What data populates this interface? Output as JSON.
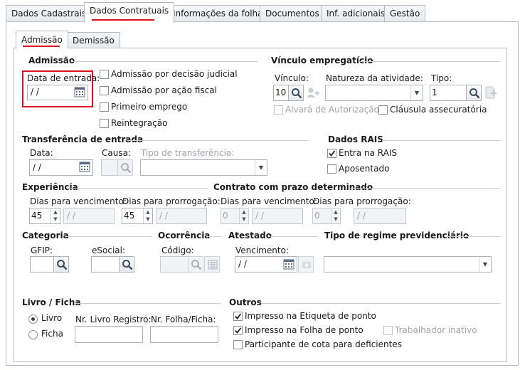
{
  "tabs": [
    "Dados Cadastrais",
    "Dados Contratuais",
    "Informações da folha",
    "Documentos",
    "Inf. adicionais",
    "Gestão"
  ],
  "subtabs": [
    "Admissão",
    "Demissão"
  ],
  "admissao": {
    "title": "Admissão",
    "data_entrada_label": "Data de entrada:",
    "data_entrada_value": " /  /",
    "checks": [
      "Admissão por decisão judicial",
      "Admissão por ação fiscal",
      "Primeiro emprego",
      "Reintegração"
    ]
  },
  "vinculo": {
    "title": "Vínculo empregatício",
    "vinculo_label": "Vínculo:",
    "vinculo_value": "10",
    "natureza_label": "Natureza da atividade:",
    "tipo_label": "Tipo:",
    "tipo_value": "1",
    "alvara": "Alvará de Autorização",
    "clausula": "Cláusula assecuratória"
  },
  "transferencia": {
    "title": "Transferência de entrada",
    "data_label": "Data:",
    "data_value": " /  /",
    "causa_label": "Causa:",
    "tipo_label": "Tipo de transferência:"
  },
  "rais": {
    "title": "Dados RAIS",
    "entra": "Entra na RAIS",
    "aposentado": "Aposentado"
  },
  "experiencia": {
    "title": "Experiência",
    "venc_label": "Dias para vencimento:",
    "venc_value": "45",
    "venc_date": " /  /",
    "prorrog_label": "Dias para prorrogação:",
    "prorrog_value": "45",
    "prorrog_date": " /  /"
  },
  "contrato": {
    "title": "Contrato com prazo determinado",
    "venc_label": "Dias para vencimento:",
    "venc_value": "0",
    "venc_date": " /  /",
    "prorrog_label": "Dias para prorrogação:",
    "prorrog_value": "0",
    "prorrog_date": " /  /"
  },
  "categoria": {
    "title": "Categoria",
    "gfip": "GFIP:",
    "esocial": "eSocial:"
  },
  "ocorrencia": {
    "title": "Ocorrência",
    "codigo": "Código:"
  },
  "atestado": {
    "title": "Atestado",
    "venc_label": "Vencimento:",
    "venc_value": " /  /"
  },
  "regime": {
    "title": "Tipo de regime previdenciário"
  },
  "livro": {
    "title": "Livro / Ficha",
    "opt_livro": "Livro",
    "opt_ficha": "Ficha",
    "nr_livro": "Nr. Livro Registro:",
    "nr_folha": "Nr. Folha/Ficha:"
  },
  "outros": {
    "title": "Outros",
    "etiqueta": "Impresso na Etiqueta de ponto",
    "folha": "Impresso na Folha de ponto",
    "inativo": "Trabalhador inativo",
    "cota": "Participante de cota para deficientes"
  },
  "colors": {
    "highlight": "#e0101e",
    "border": "#b6bcc6"
  }
}
